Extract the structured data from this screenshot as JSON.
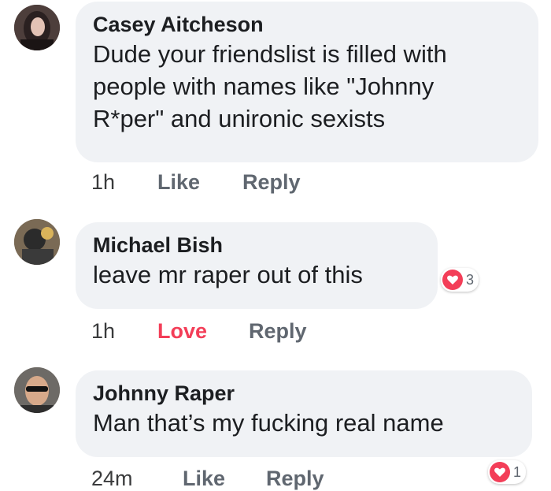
{
  "comments": [
    {
      "author": "Casey Aitcheson",
      "text_lines": [
        "Dude your friendslist is filled with",
        "people with names like \"Johnny",
        "R*per\" and unironic sexists"
      ],
      "time": "1h",
      "reaction_action": "Like",
      "reply_label": "Reply"
    },
    {
      "author": "Michael Bish",
      "text": "leave mr raper out of this",
      "reaction_icon": "heart-icon",
      "reaction_count": "3",
      "time": "1h",
      "reaction_action": "Love",
      "reply_label": "Reply"
    },
    {
      "author": "Johnny Raper",
      "text": "Man that’s my fucking real name",
      "reaction_icon": "heart-icon",
      "reaction_count": "1",
      "time": "24m",
      "reaction_action": "Like",
      "reply_label": "Reply"
    }
  ],
  "colors": {
    "bubble": "#f0f2f5",
    "love": "#f33e58",
    "action": "#606770"
  }
}
